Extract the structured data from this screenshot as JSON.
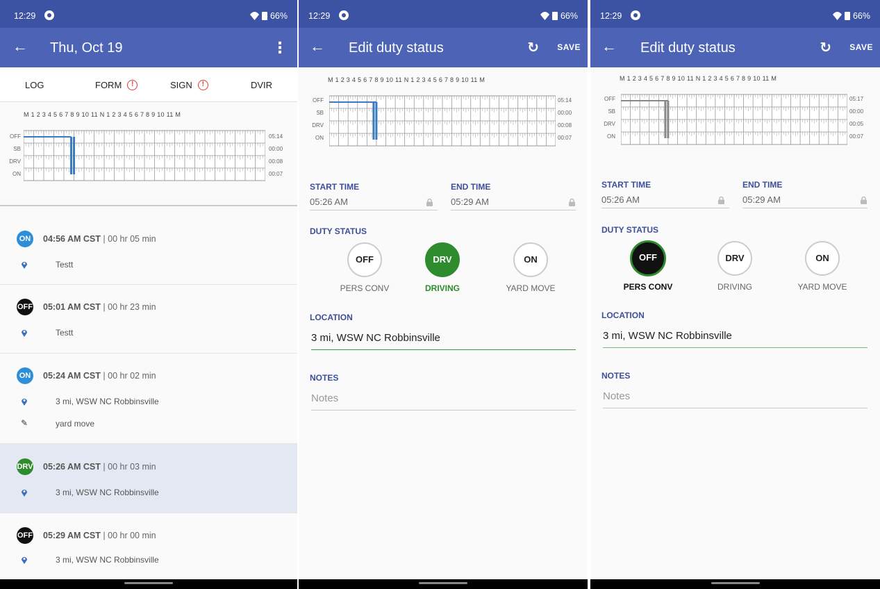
{
  "status_bar": {
    "time": "12:29",
    "battery": "66%"
  },
  "colors": {
    "status_bar": "#3c52a3",
    "app_bar": "#4c63b6",
    "on": "#2d8fd8",
    "off": "#111111",
    "drv": "#2e8b2e",
    "chart_line": "#3a7bbf",
    "alert": "#e53935"
  },
  "grid": {
    "hour_labels": "M 1 2 3 4 5 6 7 8 9 10 11 N 1 2 3 4 5 6 7 8 9 10 11 M",
    "row_labels": [
      "OFF",
      "SB",
      "DRV",
      "ON"
    ]
  },
  "log_screen": {
    "title": "Thu, Oct 19",
    "tabs": [
      {
        "label": "LOG"
      },
      {
        "label": "FORM"
      },
      {
        "label": "SIGN"
      },
      {
        "label": "DVIR"
      }
    ],
    "totals": [
      "05:14",
      "00:00",
      "00:08",
      "00:07"
    ],
    "events": [
      {
        "badge": "ON",
        "time": "04:56 AM CST",
        "duration": "| 00 hr 05 min",
        "location": "Testt",
        "note": ""
      },
      {
        "badge": "OFF",
        "time": "05:01 AM CST",
        "duration": "| 00 hr 23 min",
        "location": "Testt",
        "note": ""
      },
      {
        "badge": "ON",
        "time": "05:24 AM CST",
        "duration": "| 00 hr 02 min",
        "location": "3 mi, WSW NC Robbinsville",
        "note": "yard move"
      },
      {
        "badge": "DRV",
        "time": "05:26 AM CST",
        "duration": "| 00 hr 03 min",
        "location": "3 mi, WSW NC Robbinsville",
        "note": ""
      },
      {
        "badge": "OFF",
        "time": "05:29 AM CST",
        "duration": "| 00 hr 00 min",
        "location": "3 mi, WSW NC Robbinsville",
        "note": ""
      }
    ]
  },
  "edit_screen_1": {
    "title": "Edit duty status",
    "save": "SAVE",
    "totals": [
      "05:14",
      "00:00",
      "00:08",
      "00:07"
    ],
    "start_time_label": "START TIME",
    "start_time": "05:26 AM",
    "end_time_label": "END TIME",
    "end_time": "05:29 AM",
    "duty_status_label": "DUTY STATUS",
    "duty_buttons": [
      {
        "label": "OFF",
        "caption": "PERS CONV"
      },
      {
        "label": "DRV",
        "caption": "DRIVING"
      },
      {
        "label": "ON",
        "caption": "YARD MOVE"
      }
    ],
    "selected_duty": "DRV",
    "location_label": "LOCATION",
    "location": "3 mi, WSW NC Robbinsville",
    "notes_label": "NOTES",
    "notes_placeholder": "Notes"
  },
  "edit_screen_2": {
    "title": "Edit duty status",
    "save": "SAVE",
    "totals": [
      "05:17",
      "00:00",
      "00:05",
      "00:07"
    ],
    "start_time_label": "START TIME",
    "start_time": "05:26 AM",
    "end_time_label": "END TIME",
    "end_time": "05:29 AM",
    "duty_status_label": "DUTY STATUS",
    "duty_buttons": [
      {
        "label": "OFF",
        "caption": "PERS CONV"
      },
      {
        "label": "DRV",
        "caption": "DRIVING"
      },
      {
        "label": "ON",
        "caption": "YARD MOVE"
      }
    ],
    "selected_duty": "OFF",
    "location_label": "LOCATION",
    "location": "3 mi, WSW NC Robbinsville",
    "notes_label": "NOTES",
    "notes_placeholder": "Notes"
  }
}
